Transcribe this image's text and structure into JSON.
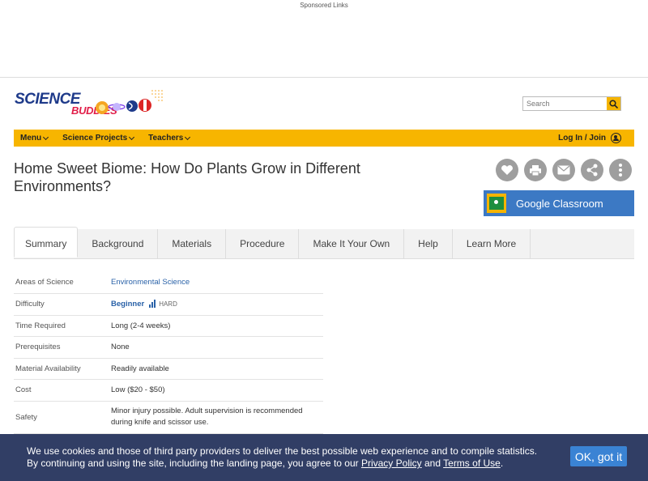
{
  "ad": {
    "sponsored_label": "Sponsored Links"
  },
  "header": {
    "logo_line1": "SCIENCE",
    "logo_line2": "BUDDIES",
    "search_placeholder": "Search"
  },
  "nav": {
    "items": [
      {
        "label": "Menu"
      },
      {
        "label": "Science Projects"
      },
      {
        "label": "Teachers"
      }
    ],
    "login_label": "Log In / Join"
  },
  "project": {
    "title": "Home Sweet Biome: How Do Plants Grow in Different Environments?"
  },
  "actions": {
    "icons": [
      "heart-icon",
      "print-icon",
      "email-icon",
      "share-icon",
      "more-icon"
    ],
    "google_classroom_label": "Google Classroom"
  },
  "tabs": [
    {
      "label": "Summary"
    },
    {
      "label": "Background"
    },
    {
      "label": "Materials"
    },
    {
      "label": "Procedure"
    },
    {
      "label": "Make It Your Own"
    },
    {
      "label": "Help"
    },
    {
      "label": "Learn More"
    }
  ],
  "summary": {
    "rows": [
      {
        "key": "Areas of Science",
        "value": "Environmental Science"
      },
      {
        "key": "Difficulty",
        "value": "Beginner",
        "extra": "HARD"
      },
      {
        "key": "Time Required",
        "value": "Long (2-4 weeks)"
      },
      {
        "key": "Prerequisites",
        "value": "None"
      },
      {
        "key": "Material Availability",
        "value": "Readily available"
      },
      {
        "key": "Cost",
        "value": "Low ($20 - $50)"
      },
      {
        "key": "Safety",
        "value": "Minor injury possible. Adult supervision is recommended during knife and scissor use."
      }
    ]
  },
  "cookie": {
    "text_line1": "We use cookies and those of third party providers to deliver the best possible web experience and to compile statistics.",
    "text_line2_pre": "By continuing and using the site, including the landing page, you agree to our ",
    "privacy_link": "Privacy Policy",
    "and": " and ",
    "terms_link": "Terms of Use",
    "end": ".",
    "ok_label": "OK, got it"
  }
}
